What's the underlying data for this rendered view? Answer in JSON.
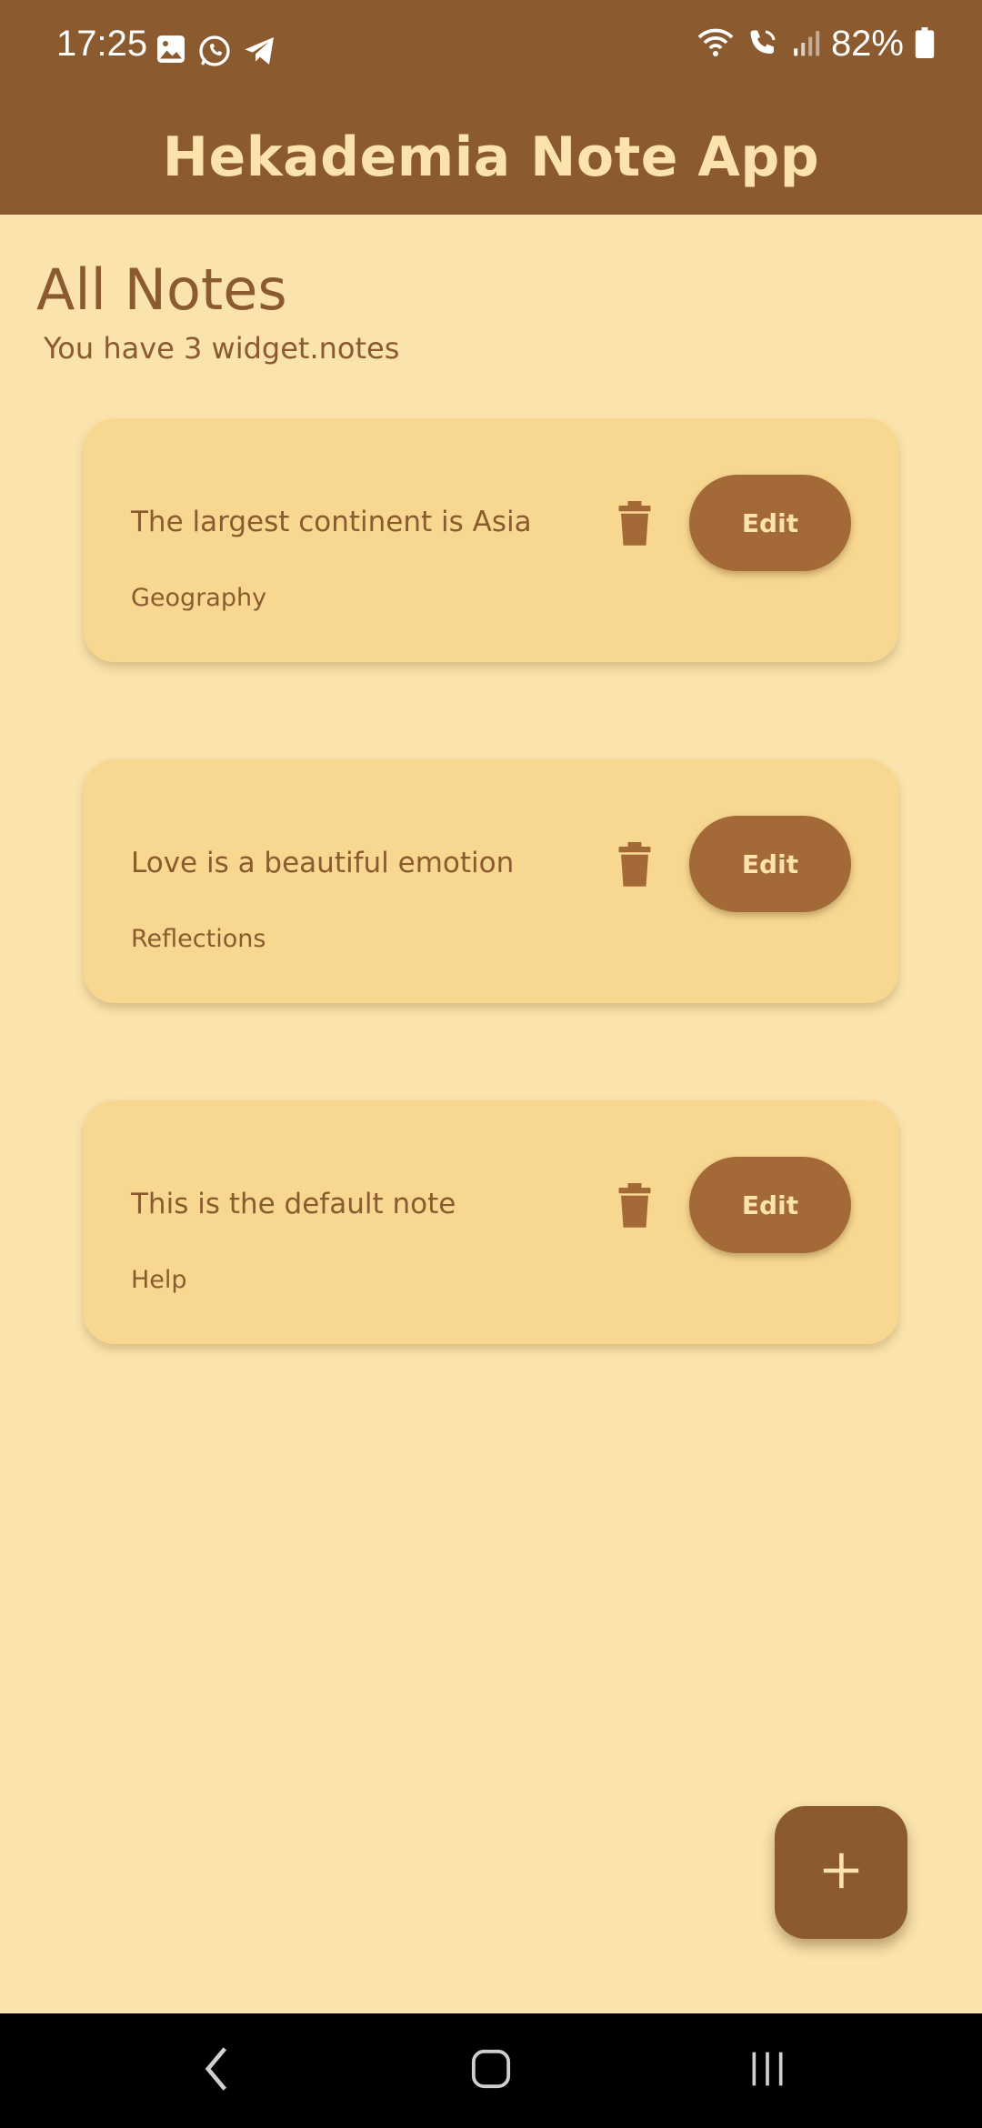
{
  "status_bar": {
    "time": "17:25",
    "battery": "82%",
    "left_icons": [
      "image-icon",
      "whatsapp-icon",
      "telegram-icon"
    ],
    "right_icons": [
      "wifi-icon",
      "wifi-call-icon",
      "signal-icon",
      "battery-icon"
    ]
  },
  "app_bar": {
    "title": "Hekademia Note App"
  },
  "main": {
    "title": "All Notes",
    "subtitle": "You have 3 widget.notes"
  },
  "notes": [
    {
      "title": "The largest continent is Asia",
      "category": "Geography",
      "edit_label": "Edit"
    },
    {
      "title": "Love is a beautiful emotion",
      "category": "Reflections",
      "edit_label": "Edit"
    },
    {
      "title": "This is the default note",
      "category": "Help",
      "edit_label": "Edit"
    }
  ],
  "fab": {
    "icon": "plus-icon"
  },
  "nav_bar": {
    "buttons": [
      "back-icon",
      "home-icon",
      "recents-icon"
    ]
  },
  "colors": {
    "brand": "#8B5A2F",
    "background": "#FAE3AC",
    "card": "#F8D891",
    "button": "#A36A37",
    "on_brand": "#FCE3AE"
  }
}
